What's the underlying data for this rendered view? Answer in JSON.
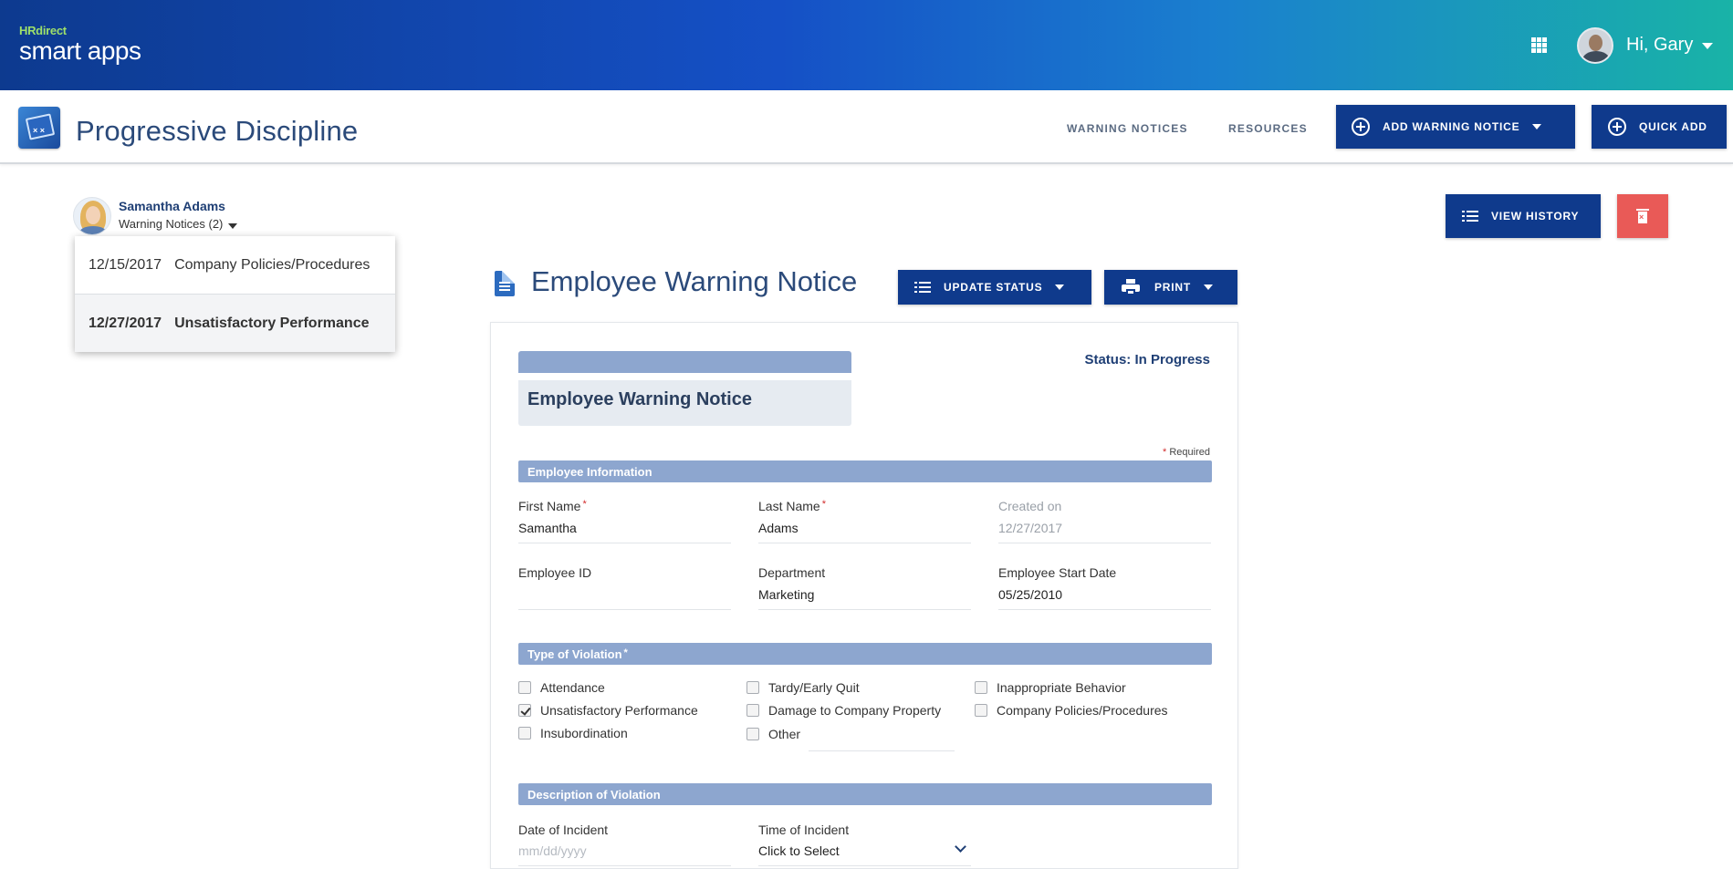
{
  "header": {
    "logo_hr": "HRdirect",
    "logo_name": "smart apps",
    "greeting": "Hi, Gary"
  },
  "app": {
    "title": "Progressive Discipline",
    "nav": [
      "WARNING NOTICES",
      "RESOURCES"
    ],
    "add_warning_label": "ADD WARNING NOTICE",
    "quick_add_label": "QUICK ADD"
  },
  "employee": {
    "name": "Samantha Adams",
    "notices_label": "Warning Notices (2)",
    "notices": [
      {
        "date": "12/15/2017",
        "type": "Company Policies/Procedures"
      },
      {
        "date": "12/27/2017",
        "type": "Unsatisfactory Performance"
      }
    ]
  },
  "actions": {
    "view_history": "VIEW HISTORY",
    "update_status": "UPDATE STATUS",
    "print": "PRINT"
  },
  "notice": {
    "page_title": "Employee Warning Notice",
    "banner_title": "Employee Warning Notice",
    "status": "Status: In Progress",
    "required_note": "Required",
    "required_marker": "*"
  },
  "sections": {
    "employee_info": "Employee Information",
    "violation_type": "Type of Violation",
    "description": "Description of Violation"
  },
  "fields": {
    "first_name": {
      "label": "First Name",
      "value": "Samantha"
    },
    "last_name": {
      "label": "Last Name",
      "value": "Adams"
    },
    "created_on": {
      "label": "Created on",
      "value": "12/27/2017"
    },
    "employee_id": {
      "label": "Employee ID",
      "value": ""
    },
    "department": {
      "label": "Department",
      "value": "Marketing"
    },
    "start_date": {
      "label": "Employee Start Date",
      "value": "05/25/2010"
    },
    "incident_date": {
      "label": "Date of Incident",
      "placeholder": "mm/dd/yyyy"
    },
    "incident_time": {
      "label": "Time of Incident",
      "value": "Click to Select"
    }
  },
  "violations": [
    {
      "label": "Attendance",
      "checked": false
    },
    {
      "label": "Unsatisfactory Performance",
      "checked": true
    },
    {
      "label": "Insubordination",
      "checked": false
    },
    {
      "label": "Tardy/Early Quit",
      "checked": false
    },
    {
      "label": "Damage to Company Property",
      "checked": false
    },
    {
      "label": "Other",
      "checked": false
    },
    {
      "label": "Inappropriate Behavior",
      "checked": false
    },
    {
      "label": "Company Policies/Procedures",
      "checked": false
    }
  ],
  "colors": {
    "brand_dark": "#0f3a8c",
    "section_bar": "#8da6cf",
    "danger": "#e95a57",
    "title_text": "#2b4a7a"
  }
}
